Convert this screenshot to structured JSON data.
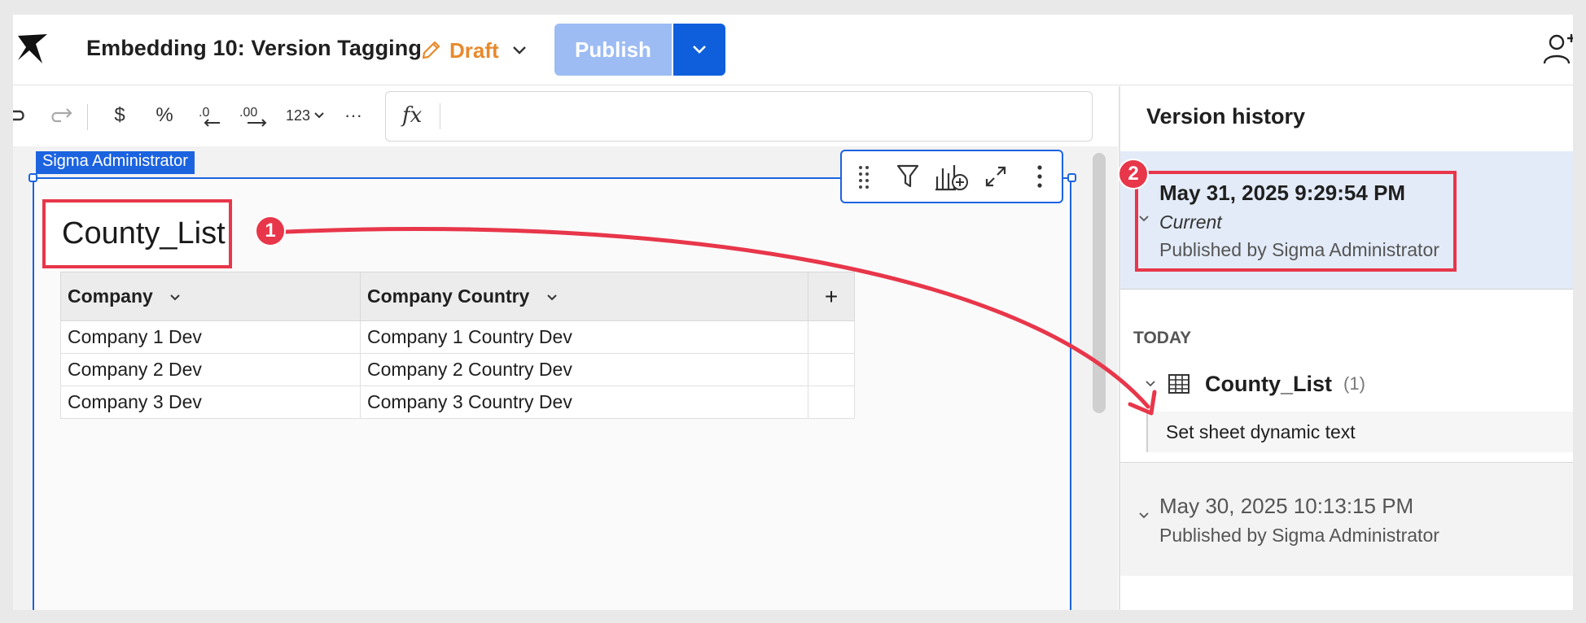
{
  "header": {
    "doc_title": "Embedding 10: Version Tagging",
    "draft_label": "Draft",
    "publish_label": "Publish"
  },
  "toolbar": {
    "currency_label": "$",
    "percent_label": "%",
    "number_format_label": "123",
    "more_label": "···",
    "formula_icon": "fx"
  },
  "element": {
    "owner_tag": "Sigma Administrator",
    "table_title": "County_List",
    "columns": [
      "Company",
      "Company Country"
    ],
    "add_column_label": "+",
    "rows": [
      [
        "Company 1 Dev",
        "Company 1 Country Dev"
      ],
      [
        "Company 2 Dev",
        "Company 2 Country Dev"
      ],
      [
        "Company 3 Dev",
        "Company 3 Country Dev"
      ]
    ]
  },
  "panel": {
    "title": "Version history",
    "current": {
      "date": "May 31, 2025 9:29:54 PM",
      "status": "Current",
      "published_by": "Published by Sigma Administrator"
    },
    "today_label": "TODAY",
    "change": {
      "name": "County_List",
      "count": "(1)",
      "detail": "Set sheet dynamic text"
    },
    "previous": {
      "date": "May 30, 2025 10:13:15 PM",
      "published_by": "Published by Sigma Administrator"
    }
  },
  "annotations": {
    "badge_1": "1",
    "badge_2": "2",
    "color": "#e8364a"
  },
  "colors": {
    "accent_blue": "#1c63e0",
    "publish_disabled": "#9dbcf3",
    "draft_orange": "#e8892c",
    "current_version_bg": "#e3ebf8"
  }
}
